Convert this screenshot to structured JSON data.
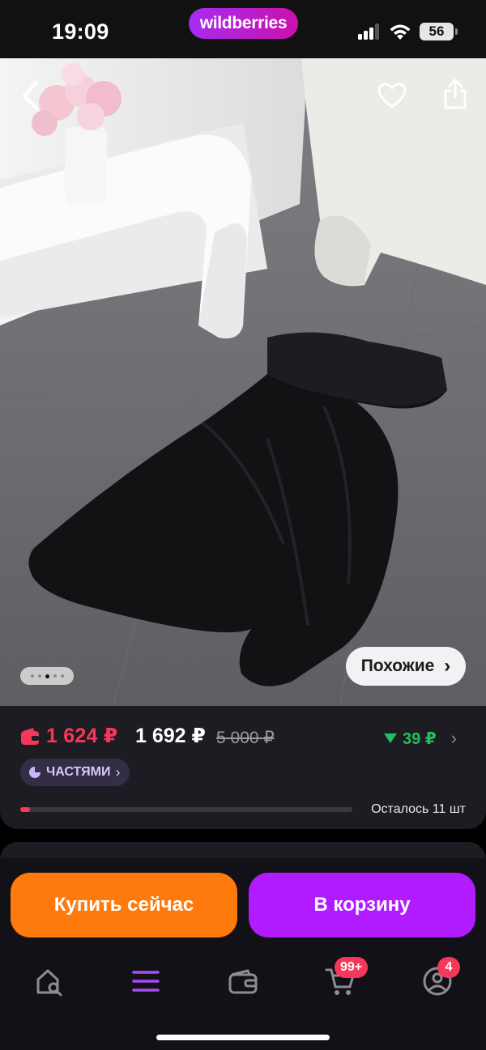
{
  "status_bar": {
    "time": "19:09",
    "battery": "56"
  },
  "brand": {
    "name": "wildberries"
  },
  "photo": {
    "similar_label": "Похожие",
    "similar_chevron": "›",
    "icons": {
      "back": "chevron-left-icon",
      "favorite": "heart-icon",
      "share": "share-icon"
    },
    "gallery_pages": 5,
    "gallery_active_index": 2
  },
  "price": {
    "wallet_price": "1 624 ₽",
    "price": "1 692 ₽",
    "old_price": "5 000 ₽",
    "discount": "39 ₽",
    "discount_chevron": "›",
    "installments": "ЧАСТЯМИ",
    "installments_chevron": "›",
    "stock_text": "Осталось 11 шт",
    "stock_fraction": 0.03
  },
  "actions": {
    "buy_now": "Купить сейчас",
    "add_to_cart": "В корзину"
  },
  "tab_bar": {
    "items": [
      {
        "name": "home-search",
        "icon": "home-search-icon"
      },
      {
        "name": "catalog",
        "icon": "menu-icon"
      },
      {
        "name": "wallet",
        "icon": "wallet-icon"
      },
      {
        "name": "cart",
        "icon": "cart-icon",
        "badge": "99+"
      },
      {
        "name": "profile",
        "icon": "profile-icon",
        "badge": "4"
      }
    ]
  },
  "colors": {
    "accent_purple": "#b01cff",
    "accent_orange": "#ff7a0d",
    "price_red": "#f5385a",
    "discount_green": "#21c05e"
  }
}
